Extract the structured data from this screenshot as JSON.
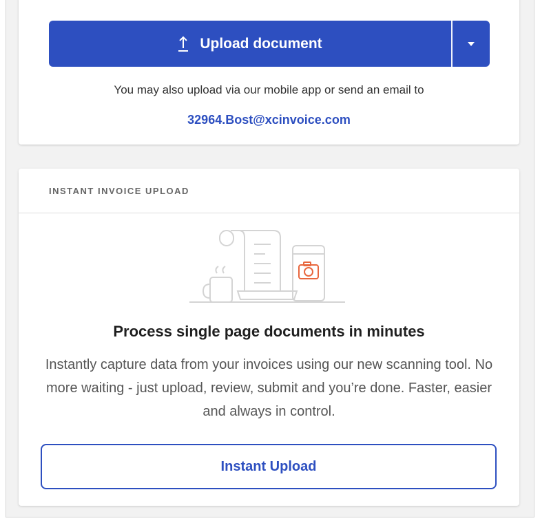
{
  "upload": {
    "button_label": "Upload document",
    "note": "You may also upload via our mobile app or send an email to",
    "email": "32964.Bost@xcinvoice.com"
  },
  "instant": {
    "header": "INSTANT INVOICE UPLOAD",
    "title": "Process single page documents in minutes",
    "description": "Instantly capture data from your invoices using our new scanning tool. No more waiting - just upload, review, submit and you’re done. Faster, easier and always in control.",
    "button_label": "Instant Upload"
  },
  "colors": {
    "primary": "#2d4fc0",
    "camera_accent": "#e8663d"
  }
}
